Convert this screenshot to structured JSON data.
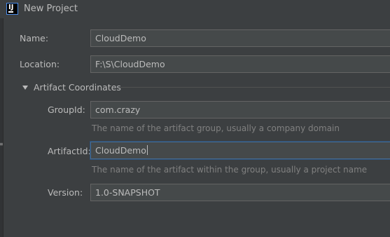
{
  "window": {
    "title": "New Project"
  },
  "name": {
    "label": "Name:",
    "value": "CloudDemo"
  },
  "location": {
    "label": "Location:",
    "value": "F:\\S\\CloudDemo"
  },
  "artifact_section": {
    "label": "Artifact Coordinates",
    "expanded": true
  },
  "group_id": {
    "label": "GroupId:",
    "value": "com.crazy",
    "hint": "The name of the artifact group, usually a company domain"
  },
  "artifact_id": {
    "label": "ArtifactId:",
    "value": "CloudDemo",
    "hint": "The name of the artifact within the group, usually a project name"
  },
  "version": {
    "label": "Version:",
    "value": "1.0-SNAPSHOT"
  },
  "icons": {
    "app": "intellij-idea-icon",
    "expander": "triangle-down-icon"
  },
  "colors": {
    "background": "#3c3f41",
    "field_bg": "#45494a",
    "focus_border": "#466d94",
    "hint_text": "#808080"
  }
}
